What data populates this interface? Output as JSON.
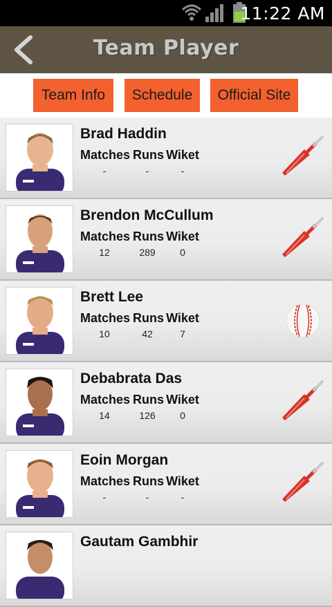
{
  "status_bar": {
    "time": "11:22 AM",
    "icons": [
      "wifi-icon",
      "signal-icon",
      "battery-icon"
    ]
  },
  "header": {
    "title": "Team Player",
    "back_icon": "back-arrow-icon"
  },
  "tabs": [
    {
      "label": "Team Info"
    },
    {
      "label": "Schedule"
    },
    {
      "label": "Official Site"
    }
  ],
  "stat_headers": {
    "matches": "Matches",
    "runs": "Runs",
    "wiket": "Wiket"
  },
  "players": [
    {
      "name": "Brad Haddin",
      "matches": "-",
      "runs": "-",
      "wiket": "-",
      "role_icon": "cricket-bat-icon"
    },
    {
      "name": "Brendon McCullum",
      "matches": "12",
      "runs": "289",
      "wiket": "0",
      "role_icon": "cricket-bat-icon"
    },
    {
      "name": "Brett Lee",
      "matches": "10",
      "runs": "42",
      "wiket": "7",
      "role_icon": "cricket-ball-icon"
    },
    {
      "name": "Debabrata Das",
      "matches": "14",
      "runs": "126",
      "wiket": "0",
      "role_icon": "cricket-bat-icon"
    },
    {
      "name": "Eoin Morgan",
      "matches": "-",
      "runs": "-",
      "wiket": "-",
      "role_icon": "cricket-bat-icon"
    },
    {
      "name": "Gautam Gambhir",
      "matches": "",
      "runs": "",
      "wiket": "",
      "role_icon": ""
    }
  ],
  "colors": {
    "tab_bg": "#f3612f",
    "jersey": "#3a2a72",
    "bat": "#d8332a"
  }
}
